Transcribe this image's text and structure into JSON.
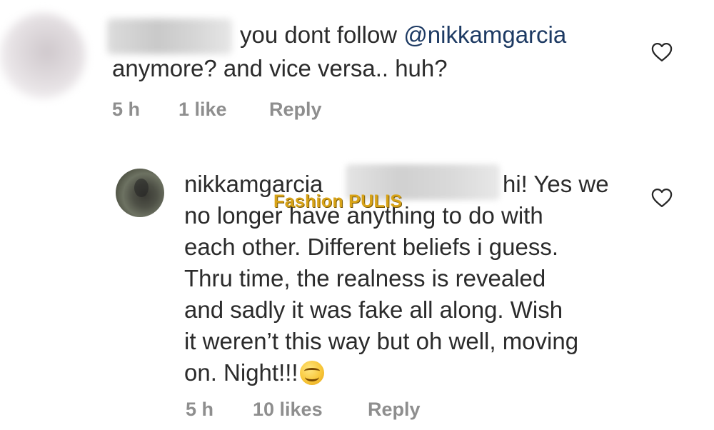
{
  "comments": [
    {
      "lines": [
        {
          "before": "you dont follow ",
          "mention": "@nikkamgarcia"
        },
        {
          "text": "anymore? and vice versa.. huh?"
        }
      ],
      "time": "5 h",
      "likes": "1 like",
      "reply": "Reply"
    },
    {
      "username": "nikkamgarcia",
      "lines": [
        "hi! Yes we",
        "no longer have anything to do with",
        "each other. Different beliefs i guess.",
        "Thru time, the  realness is revealed",
        "and sadly it was fake all along. Wish",
        "it weren’t this way but oh well, moving",
        "on. Night!!!"
      ],
      "emoji": "smiling-face-emoji",
      "time": "5 h",
      "likes": "10 likes",
      "reply": "Reply"
    }
  ],
  "watermark": "Fashion PULIS",
  "icons": {
    "like": "heart-outline-icon"
  }
}
